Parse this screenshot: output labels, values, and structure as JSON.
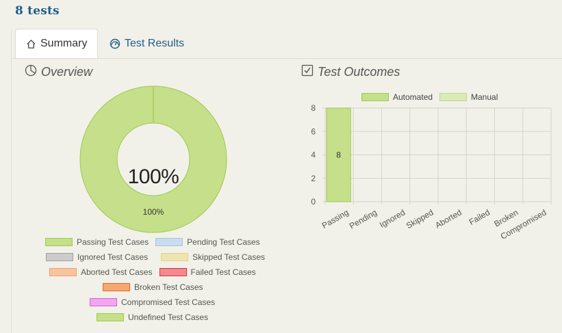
{
  "header": {
    "title": "8 tests"
  },
  "tabs": [
    {
      "label": "Summary",
      "icon": "home-icon",
      "active": true
    },
    {
      "label": "Test Results",
      "icon": "gauge-icon",
      "active": false
    }
  ],
  "overview": {
    "title": "Overview",
    "icon": "pie-chart-icon",
    "center_text": "100%",
    "slice_label": "100%",
    "legend": [
      {
        "label": "Passing Test Cases",
        "fill": "#c5df8a",
        "stroke": "#9fca4f"
      },
      {
        "label": "Pending Test Cases",
        "fill": "#c9dcf0",
        "stroke": "#a9c3e0"
      },
      {
        "label": "Ignored Test Cases",
        "fill": "#cccccc",
        "stroke": "#a0a0a0"
      },
      {
        "label": "Skipped Test Cases",
        "fill": "#efe3b0",
        "stroke": "#e3d48a"
      },
      {
        "label": "Aborted Test Cases",
        "fill": "#f7c4a0",
        "stroke": "#f0a070"
      },
      {
        "label": "Failed Test Cases",
        "fill": "#f28a90",
        "stroke": "#d9303c"
      },
      {
        "label": "Broken Test Cases",
        "fill": "#f7a770",
        "stroke": "#e06a20"
      },
      {
        "label": "Compromised Test Cases",
        "fill": "#f2a6f2",
        "stroke": "#d760d7"
      },
      {
        "label": "Undefined Test Cases",
        "fill": "#c5df8a",
        "stroke": "#9fca4f"
      }
    ]
  },
  "outcomes": {
    "title": "Test Outcomes",
    "icon": "checkbox-icon",
    "legend": [
      {
        "label": "Automated",
        "fill": "#c5df8a",
        "stroke": "#9fca4f"
      },
      {
        "label": "Manual",
        "fill": "#dbeab8",
        "stroke": "#b9d88a"
      }
    ]
  },
  "chart_data": [
    {
      "type": "pie",
      "labels": [
        "Passing Test Cases"
      ],
      "values": [
        100
      ],
      "center_label": "100%",
      "colors": [
        "#c5df8a"
      ]
    },
    {
      "type": "bar",
      "title": "Test Outcomes",
      "categories": [
        "Passing",
        "Pending",
        "Ignored",
        "Skipped",
        "Aborted",
        "Failed",
        "Broken",
        "Compromised"
      ],
      "series": [
        {
          "name": "Automated",
          "values": [
            8,
            0,
            0,
            0,
            0,
            0,
            0,
            0
          ]
        },
        {
          "name": "Manual",
          "values": [
            0,
            0,
            0,
            0,
            0,
            0,
            0,
            0
          ]
        }
      ],
      "data_labels": [
        "8",
        "",
        "",
        "",
        "",
        "",
        "",
        ""
      ],
      "yticks": [
        0,
        2,
        4,
        6,
        8
      ],
      "ylim": [
        0,
        8
      ],
      "grid": true,
      "legend": "top"
    }
  ]
}
